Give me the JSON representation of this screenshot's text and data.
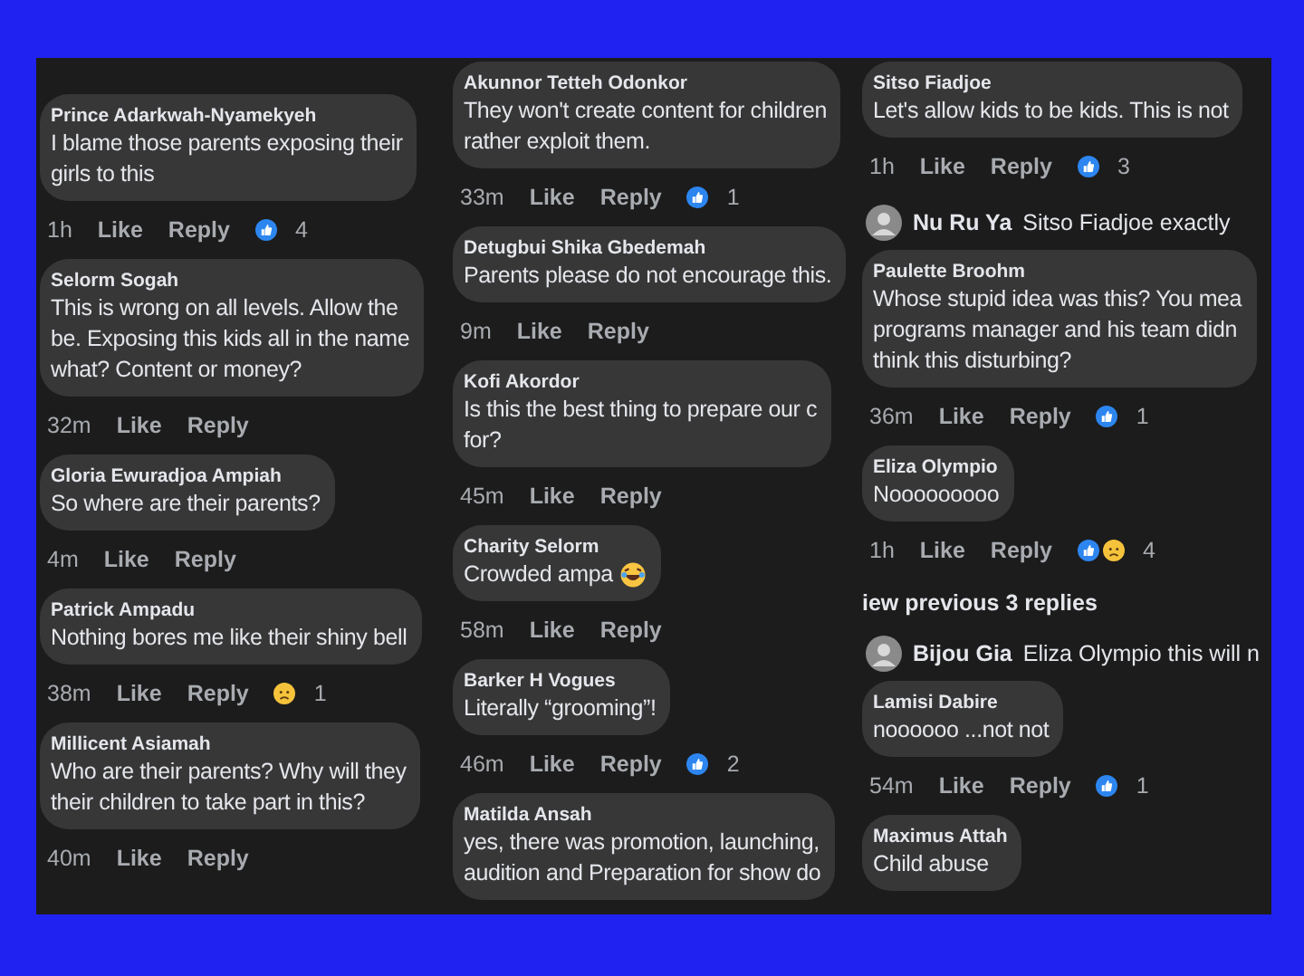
{
  "panels": [
    {
      "items": [
        {
          "kind": "comment",
          "author": "Prince Adarkwah-Nyamekyeh",
          "lines": [
            "I blame those parents  exposing their",
            "girls to this"
          ],
          "time": "1h",
          "like": "Like",
          "reply": "Reply",
          "reactions": [
            {
              "kind": "like"
            }
          ],
          "count": "4"
        },
        {
          "kind": "comment",
          "author": "Selorm Sogah",
          "lines": [
            "This is wrong on all levels. Allow the",
            "be. Exposing this kids all in the name",
            "what? Content or money?"
          ],
          "time": "32m",
          "like": "Like",
          "reply": "Reply"
        },
        {
          "kind": "comment",
          "author": "Gloria Ewuradjoa Ampiah",
          "lines": [
            "So where are their parents?"
          ],
          "time": "4m",
          "like": "Like",
          "reply": "Reply"
        },
        {
          "kind": "comment",
          "author": "Patrick Ampadu",
          "lines": [
            "Nothing bores me like their shiny bell"
          ],
          "time": "38m",
          "like": "Like",
          "reply": "Reply",
          "reactions": [
            {
              "kind": "sad"
            }
          ],
          "count": "1"
        },
        {
          "kind": "comment",
          "author": "Millicent Asiamah",
          "lines": [
            "Who are their parents? Why will they",
            "their children to take part in this?"
          ],
          "time": "40m",
          "like": "Like",
          "reply": "Reply"
        }
      ]
    },
    {
      "items": [
        {
          "kind": "comment",
          "author": "Akunnor Tetteh Odonkor",
          "lines": [
            "They won't create content for children",
            "rather exploit them."
          ],
          "time": "33m",
          "like": "Like",
          "reply": "Reply",
          "reactions": [
            {
              "kind": "like"
            }
          ],
          "count": "1"
        },
        {
          "kind": "comment",
          "author": "Detugbui Shika Gbedemah",
          "lines": [
            "Parents please do not encourage this."
          ],
          "time": "9m",
          "like": "Like",
          "reply": "Reply"
        },
        {
          "kind": "comment",
          "author": "Kofi Akordor",
          "lines": [
            "Is this the best thing to prepare our c",
            "for?"
          ],
          "time": "45m",
          "like": "Like",
          "reply": "Reply"
        },
        {
          "kind": "comment",
          "author": "Charity Selorm",
          "lines": [
            "Crowded ampa"
          ],
          "laughing_emoji": true,
          "time": "58m",
          "like": "Like",
          "reply": "Reply"
        },
        {
          "kind": "comment",
          "author": "Barker H Vogues",
          "lines": [
            "Literally “grooming”!"
          ],
          "time": "46m",
          "like": "Like",
          "reply": "Reply",
          "reactions": [
            {
              "kind": "like"
            }
          ],
          "count": "2"
        },
        {
          "kind": "comment",
          "author": "Matilda Ansah",
          "lines": [
            "yes, there was promotion, launching,",
            "audition and Preparation for show do"
          ]
        }
      ]
    },
    {
      "items": [
        {
          "kind": "comment",
          "author": "Sitso Fiadjoe",
          "lines": [
            "Let's allow kids to be kids. This is not"
          ],
          "time": "1h",
          "like": "Like",
          "reply": "Reply",
          "reactions": [
            {
              "kind": "like"
            }
          ],
          "count": "3"
        },
        {
          "kind": "inline_reply",
          "author": "Nu Ru Ya",
          "text": "Sitso Fiadjoe exactly"
        },
        {
          "kind": "comment",
          "author": "Paulette Broohm",
          "lines": [
            "Whose stupid idea was this? You mea",
            "programs manager and his team didn",
            "think this disturbing?"
          ],
          "time": "36m",
          "like": "Like",
          "reply": "Reply",
          "reactions": [
            {
              "kind": "like"
            }
          ],
          "count": "1"
        },
        {
          "kind": "comment",
          "author": "Eliza Olympio",
          "lines": [
            "Nooooooooo"
          ],
          "time": "1h",
          "like": "Like",
          "reply": "Reply",
          "reactions": [
            {
              "kind": "like"
            },
            {
              "kind": "sad"
            }
          ],
          "count": "4"
        },
        {
          "kind": "view_more",
          "text": "iew previous 3 replies"
        },
        {
          "kind": "inline_reply",
          "author": "Bijou Gia",
          "text": "Eliza Olympio this will n"
        },
        {
          "kind": "comment",
          "author": "Lamisi Dabire",
          "lines": [
            "noooooo ...not not"
          ],
          "time": "54m",
          "like": "Like",
          "reply": "Reply",
          "reactions": [
            {
              "kind": "like"
            }
          ],
          "count": "1"
        },
        {
          "kind": "comment",
          "author": "Maximus Attah",
          "lines": [
            "Child abuse"
          ]
        }
      ]
    }
  ]
}
